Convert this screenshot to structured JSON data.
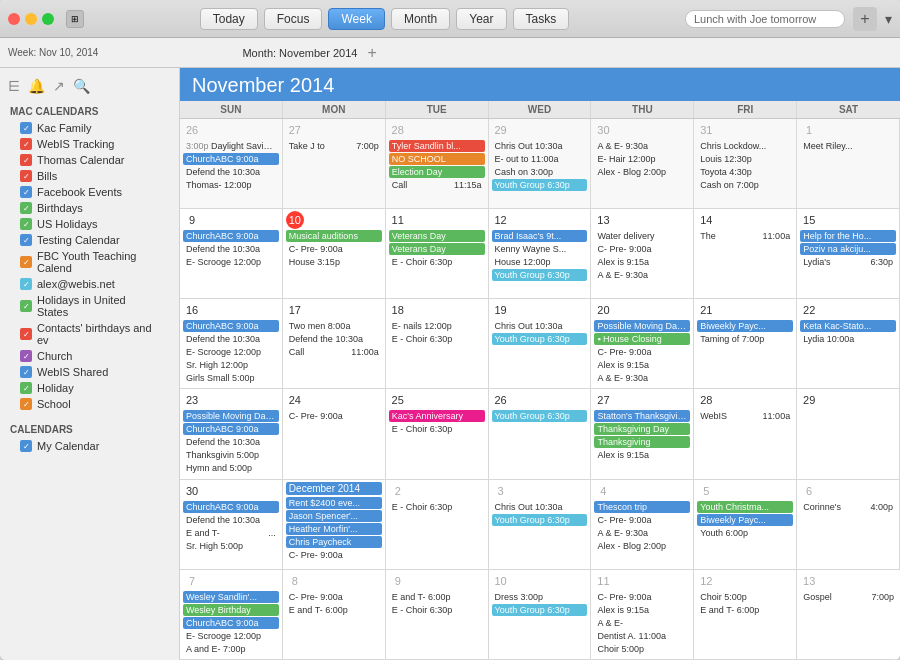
{
  "titlebar": {
    "today_label": "Today",
    "focus_label": "Focus",
    "week_label": "Week",
    "month_label": "Month",
    "year_label": "Year",
    "tasks_label": "Tasks",
    "search_placeholder": "Lunch with Joe tomorrow"
  },
  "subtoolbar": {
    "week_text": "Week: Nov 10, 2014",
    "month_text": "Month: November 2014"
  },
  "sidebar": {
    "mac_calendars_title": "MAC CALENDARS",
    "calendars_title": "CALENDARS",
    "mac_items": [
      {
        "label": "Kac Family",
        "color": "#4a90d9",
        "checked": true
      },
      {
        "label": "WebIS Tracking",
        "color": "#e74c3c",
        "checked": true
      },
      {
        "label": "Thomas Calendar",
        "color": "#e74c3c",
        "checked": true
      },
      {
        "label": "Bills",
        "color": "#e74c3c",
        "checked": true
      },
      {
        "label": "Facebook Events",
        "color": "#4a90d9",
        "checked": true
      },
      {
        "label": "Birthdays",
        "color": "#5cb85c",
        "checked": true
      },
      {
        "label": "US Holidays",
        "color": "#5cb85c",
        "checked": true
      },
      {
        "label": "Testing Calendar",
        "color": "#4a90d9",
        "checked": true
      },
      {
        "label": "FBC Youth Teaching Calend",
        "color": "#e8872a",
        "checked": true
      },
      {
        "label": "alex@webis.net",
        "color": "#5bc0de",
        "checked": true
      },
      {
        "label": "Holidays in United States",
        "color": "#5cb85c",
        "checked": true
      },
      {
        "label": "Contacts' birthdays and ev",
        "color": "#e74c3c",
        "checked": true
      },
      {
        "label": "Church",
        "color": "#9b59b6",
        "checked": true
      },
      {
        "label": "WebIS Shared",
        "color": "#4a90d9",
        "checked": true
      },
      {
        "label": "Holiday",
        "color": "#5cb85c",
        "checked": true
      },
      {
        "label": "School",
        "color": "#e8872a",
        "checked": true
      }
    ],
    "cal_items": [
      {
        "label": "My Calendar",
        "color": "#4a90d9",
        "checked": true
      }
    ]
  },
  "calendar": {
    "title": "November 2014",
    "days_header": [
      "SUN",
      "MON",
      "TUE",
      "WED",
      "THU",
      "FRI",
      "SAT"
    ]
  }
}
